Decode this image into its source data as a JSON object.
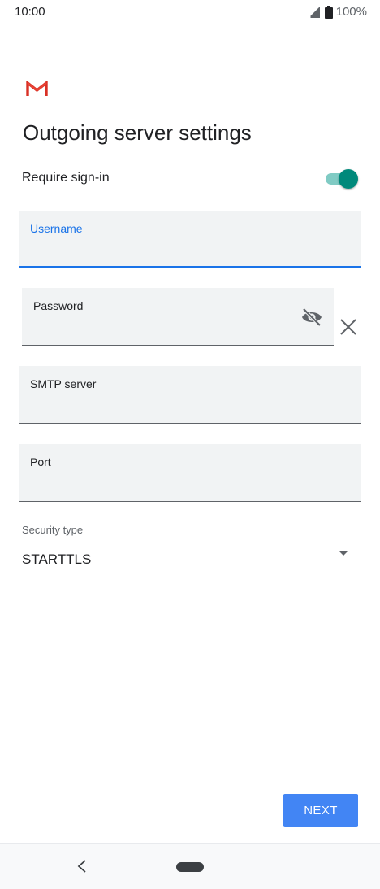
{
  "status_bar": {
    "time": "10:00",
    "battery_text": "100%",
    "icons": [
      "signal-icon",
      "battery-icon"
    ]
  },
  "app": {
    "logo": "gmail-logo",
    "title": "Outgoing server settings"
  },
  "require_signin": {
    "label": "Require sign-in",
    "enabled": true
  },
  "fields": {
    "username": {
      "label": "Username",
      "value": ""
    },
    "password": {
      "label": "Password",
      "value": ""
    },
    "smtp_server": {
      "label": "SMTP server",
      "value": ""
    },
    "port": {
      "label": "Port",
      "value": ""
    }
  },
  "security": {
    "label": "Security type",
    "selected": "STARTTLS"
  },
  "actions": {
    "next_label": "NEXT"
  },
  "colors": {
    "accent_blue": "#1a73e8",
    "button_blue": "#4285f4",
    "toggle_teal": "#00897b",
    "gmail_red": "#d93025"
  }
}
